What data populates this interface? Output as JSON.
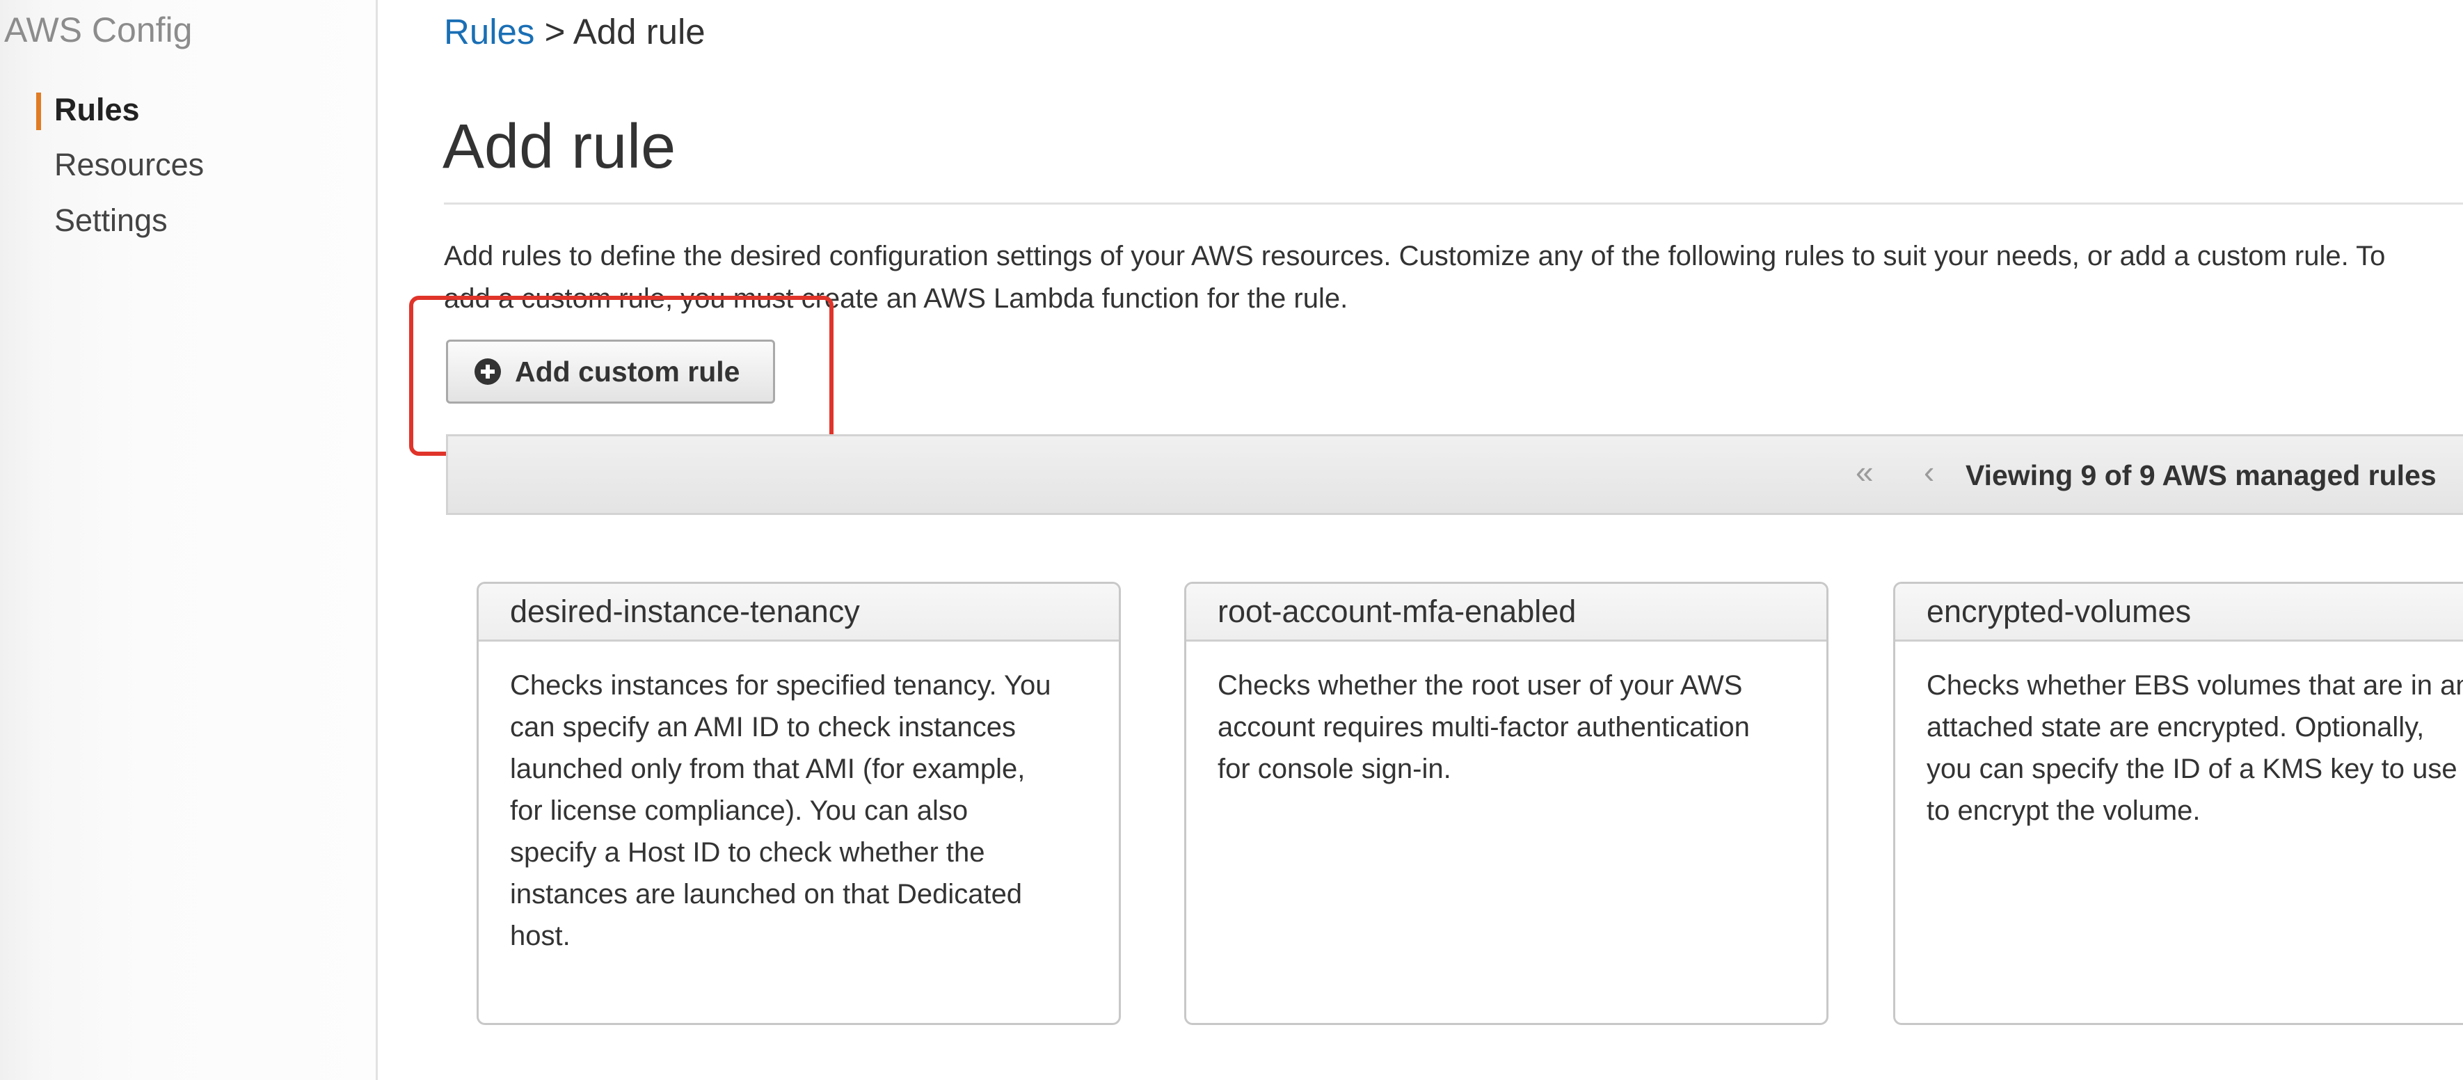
{
  "sidebar": {
    "title": "AWS Config",
    "items": [
      {
        "label": "Rules",
        "active": true
      },
      {
        "label": "Resources",
        "active": false
      },
      {
        "label": "Settings",
        "active": false
      }
    ],
    "accent_color": "#e07b24"
  },
  "breadcrumb": {
    "link": "Rules",
    "separator": ">",
    "current": "Add rule"
  },
  "page": {
    "title": "Add rule",
    "intro_lines": [
      "Add rules to define the desired configuration settings of your AWS resources. Customize any of the following rules to suit your needs, or add a custom rule. To",
      "add a custom rule, you must create an AWS Lambda function for the rule."
    ]
  },
  "add_custom_rule": {
    "label": "Add custom rule",
    "icon": "plus-circle-icon",
    "highlight_color": "#e0342a"
  },
  "pager": {
    "first_icon": "«",
    "prev_icon": "‹",
    "status": "Viewing 9 of 9 AWS managed rules"
  },
  "rules": [
    {
      "name": "desired-instance-tenancy",
      "description_lines": [
        "Checks instances for specified tenancy. You",
        "can specify an AMI ID to check instances",
        "launched only from that AMI (for example,",
        "for license compliance). You can also",
        "specify a Host ID to check whether the",
        "instances are launched on that Dedicated",
        "host."
      ]
    },
    {
      "name": "root-account-mfa-enabled",
      "description_lines": [
        "Checks whether the root user of your AWS",
        "account requires multi-factor authentication",
        "for console sign-in."
      ]
    },
    {
      "name": "encrypted-volumes",
      "description_lines": [
        "Checks whether EBS volumes that are in an",
        "attached state are encrypted. Optionally,",
        "you can specify the ID of a KMS key to use",
        "to encrypt the volume."
      ]
    }
  ]
}
